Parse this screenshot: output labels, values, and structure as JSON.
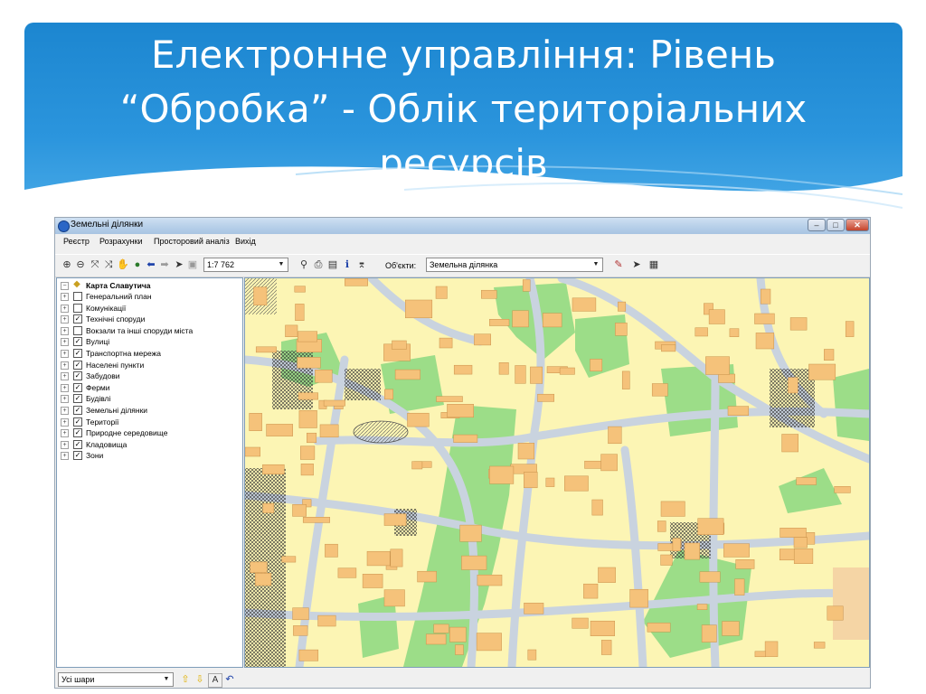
{
  "slide": {
    "title_lines": [
      "Електронне управління: Рівень",
      "“Обробка” - Облік територіальних",
      "ресурсів"
    ]
  },
  "colors": {
    "banner": "#2b95dd",
    "map_background": "#fcf5b4",
    "road": "#c9d3df",
    "building": "#f5c27a",
    "green": "#9cdd88"
  },
  "window": {
    "title": "Земельні ділянки",
    "controls": [
      "minimize",
      "maximize",
      "close"
    ],
    "menu": [
      "Реєстр",
      "Розрахунки",
      "Просторовий аналіз",
      "Вихід"
    ],
    "toolbar": {
      "icons": [
        "zoom-in-icon",
        "zoom-out-icon",
        "full-extent-icon",
        "zoom-extent-icon",
        "pan-hand-icon",
        "globe-icon",
        "back-arrow-icon",
        "forward-arrow-icon",
        "select-pointer-icon",
        "scale-icon"
      ],
      "scale_value": "1:7 762",
      "tools": [
        "binoculars-icon",
        "print-icon",
        "print-preview-icon",
        "info-icon",
        "measure-icon"
      ],
      "objects_label": "Об'єкти:",
      "objects_value": "Земельна ділянка",
      "edit_tools": [
        "pencil-icon",
        "pointer-icon",
        "calculator-icon"
      ]
    },
    "layers": {
      "root": "Карта Славутича",
      "items": [
        {
          "label": "Генеральний план",
          "checked": false
        },
        {
          "label": "Комунікації",
          "checked": false
        },
        {
          "label": "Технічні споруди",
          "checked": true
        },
        {
          "label": "Вокзали та інші споруди міста",
          "checked": false
        },
        {
          "label": "Вулиці",
          "checked": true
        },
        {
          "label": "Транспортна мережа",
          "checked": true
        },
        {
          "label": "Населені пункти",
          "checked": true
        },
        {
          "label": "Забудови",
          "checked": true
        },
        {
          "label": "Ферми",
          "checked": true
        },
        {
          "label": "Будівлі",
          "checked": true
        },
        {
          "label": "Земельні ділянки",
          "checked": true
        },
        {
          "label": "Території",
          "checked": true
        },
        {
          "label": "Природне середовище",
          "checked": true
        },
        {
          "label": "Кладовища",
          "checked": true
        },
        {
          "label": "Зони",
          "checked": true
        }
      ]
    },
    "status": {
      "layers_select": "Усі шари",
      "buttons": [
        "up-arrow-icon",
        "down-arrow-icon",
        "label-a-icon",
        "undo-icon"
      ],
      "label_a": "A"
    }
  }
}
